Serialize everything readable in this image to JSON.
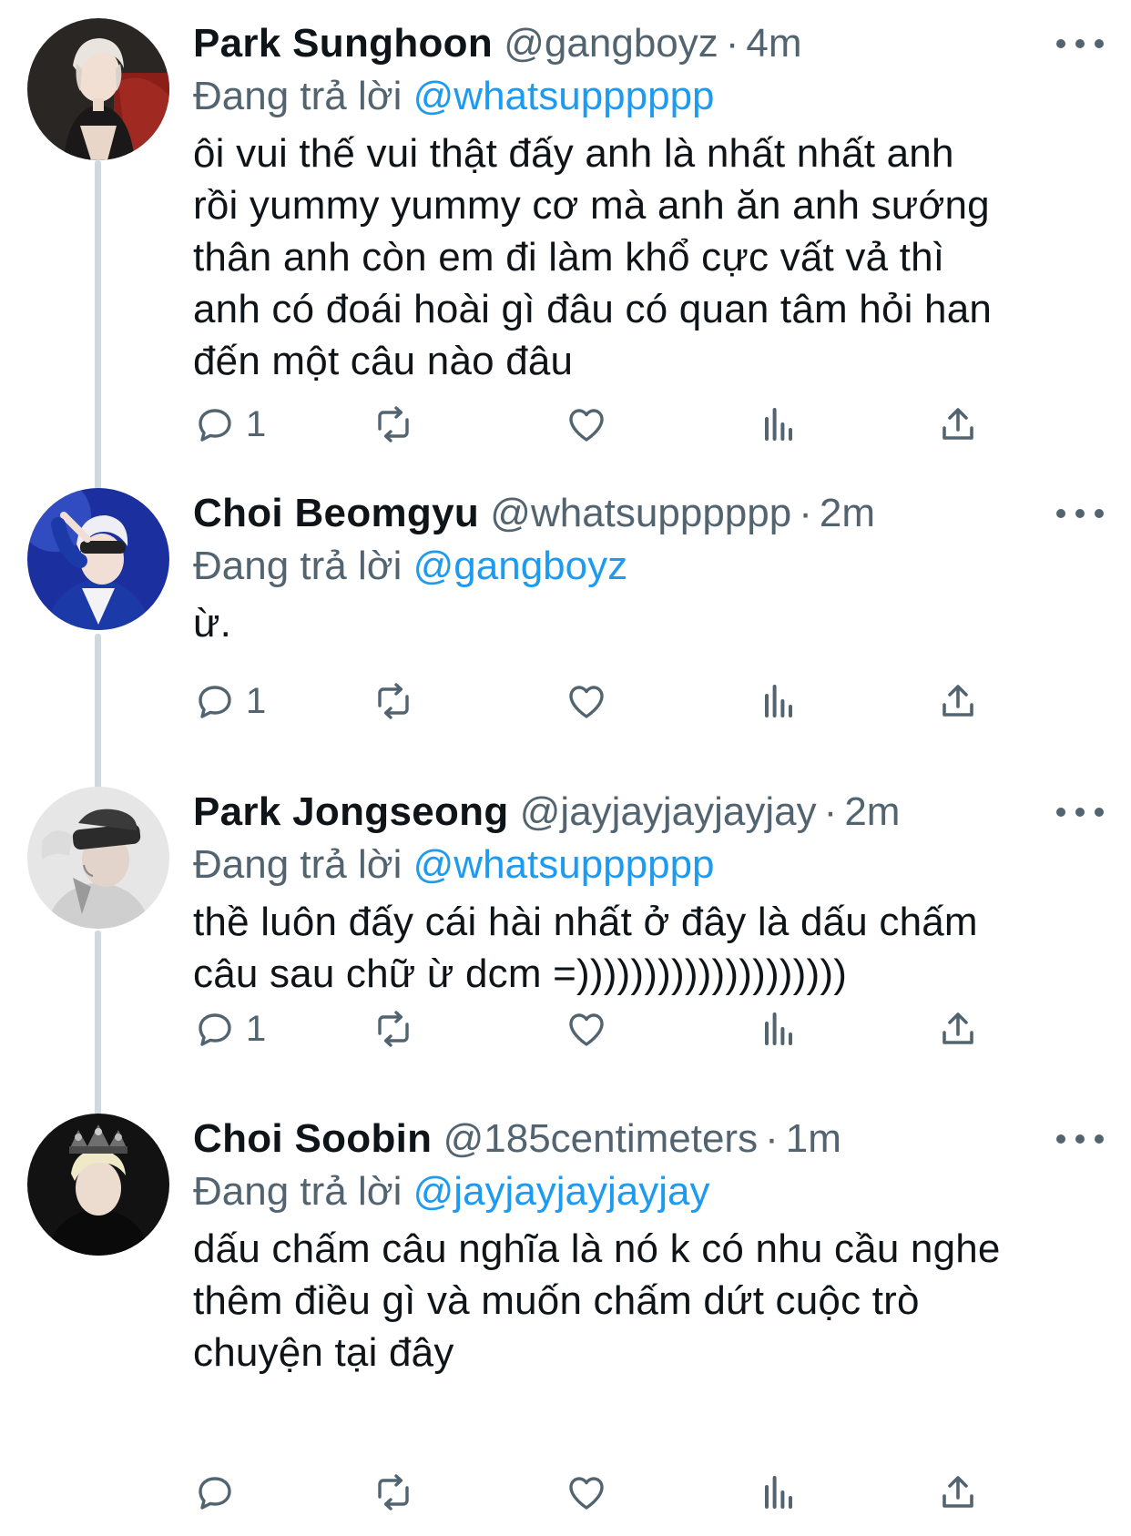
{
  "colors": {
    "name": "#0f1419",
    "secondary": "#536471",
    "mention": "#1d9bf0",
    "thread_line": "#cfd9de",
    "background": "#ffffff"
  },
  "reply_prefix": "Đang trả lời",
  "tweets": [
    {
      "name": "Park Sunghoon",
      "handle": "@gangboyz",
      "separator": "·",
      "time": "4m",
      "reply_to": "@whatsupppppp",
      "text": "ôi vui thế vui thật đấy anh là nhất nhất anh\nrồi yummy yummy cơ mà anh ăn anh sướng\nthân anh còn em đi làm khổ cực vất vả thì\nanh có đoái hoài gì đâu có quan tâm hỏi han\nđến một câu nào đâu",
      "reply_count": "1",
      "avatar_icon": "avatar-park-sunghoon"
    },
    {
      "name": "Choi Beomgyu",
      "handle": "@whatsupppppp",
      "separator": "·",
      "time": "2m",
      "reply_to": "@gangboyz",
      "text": "ừ.",
      "reply_count": "1",
      "avatar_icon": "avatar-choi-beomgyu"
    },
    {
      "name": "Park Jongseong",
      "handle": "@jayjayjayjayjay",
      "separator": "·",
      "time": "2m",
      "reply_to": "@whatsupppppp",
      "text": "thề luôn đấy cái hài nhất ở đây là dấu chấm\ncâu sau chữ ừ dcm =))))))))))))))))))))",
      "reply_count": "1",
      "avatar_icon": "avatar-park-jongseong"
    },
    {
      "name": "Choi Soobin",
      "handle": "@185centimeters",
      "separator": "·",
      "time": "1m",
      "reply_to": "@jayjayjayjayjay",
      "text": "dấu chấm câu nghĩa là nó k có nhu cầu nghe\nthêm điều gì và muốn chấm dứt cuộc trò\nchuyện tại đây",
      "reply_count": "",
      "avatar_icon": "avatar-choi-soobin"
    }
  ],
  "icons": {
    "reply": "reply-icon",
    "retweet": "retweet-icon",
    "like": "heart-icon",
    "views": "views-icon",
    "share": "share-icon",
    "more": "more-icon"
  }
}
